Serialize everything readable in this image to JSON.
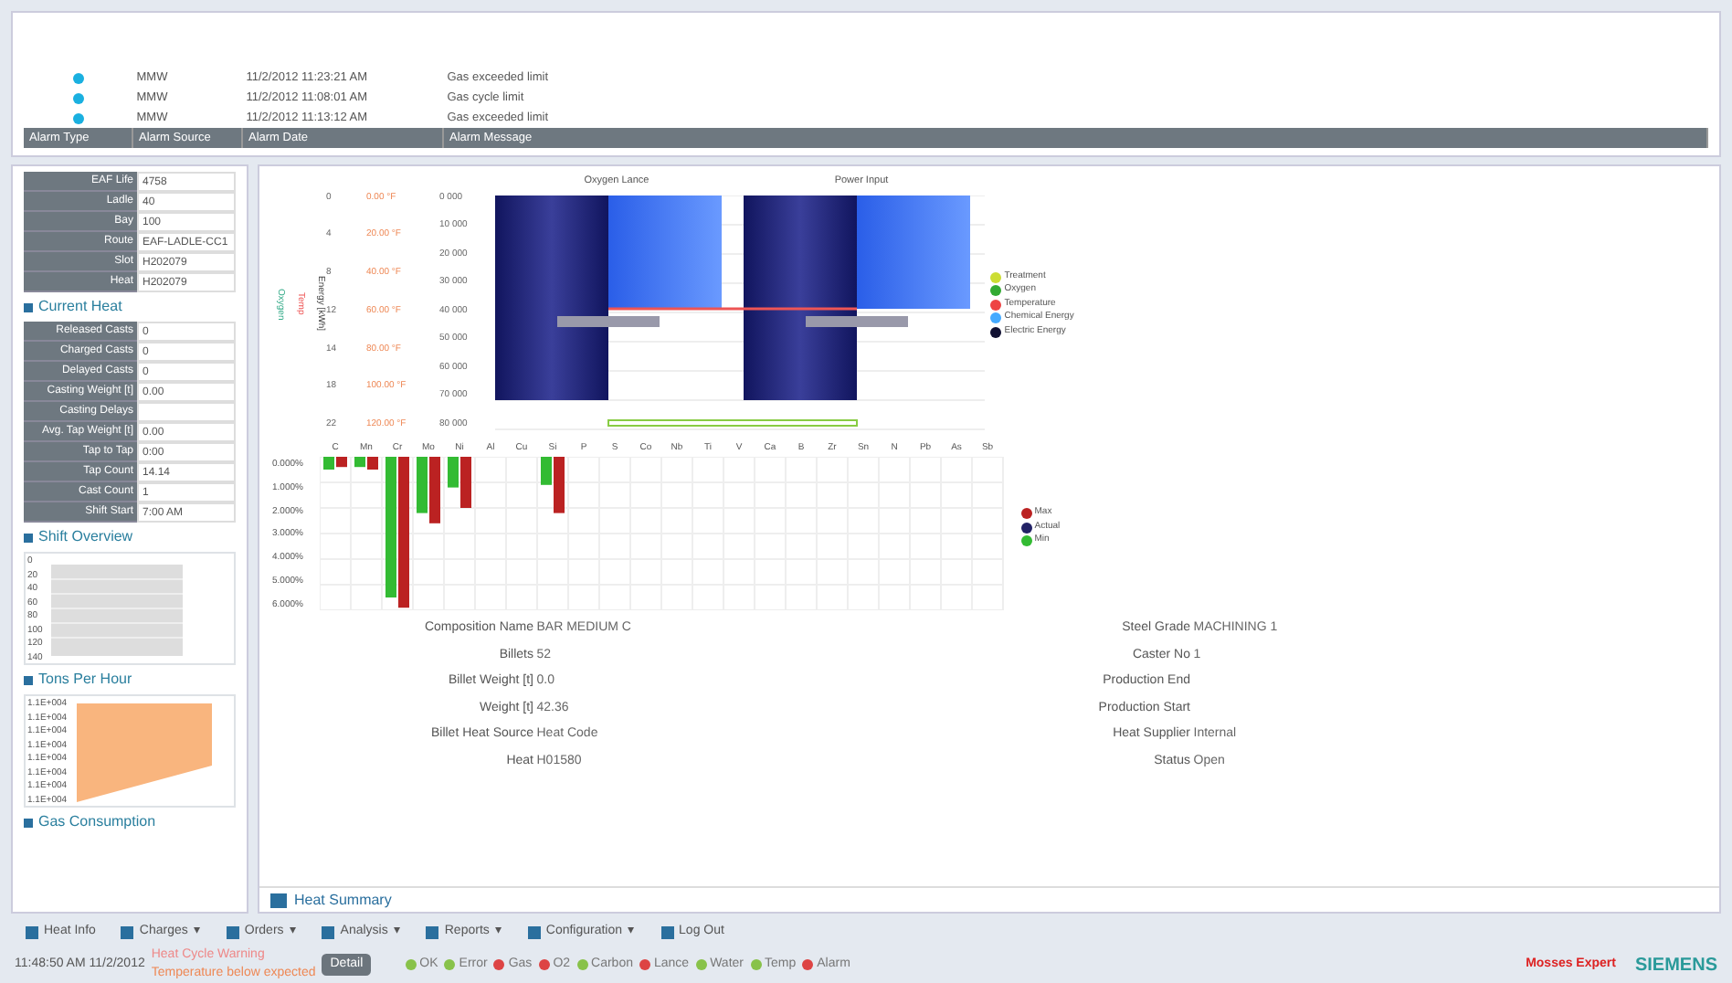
{
  "alarms": {
    "rows": [
      {
        "source": "MMW",
        "date": "11/2/2012 11:23:21 AM",
        "message": "Gas exceeded limit"
      },
      {
        "source": "MMW",
        "date": "11/2/2012 11:08:01 AM",
        "message": "Gas cycle limit"
      },
      {
        "source": "MMW",
        "date": "11/2/2012 11:13:12 AM",
        "message": "Gas exceeded limit"
      }
    ],
    "columns": [
      "Alarm Type",
      "Alarm Source",
      "Alarm Date",
      "Alarm Message"
    ]
  },
  "sidebar": {
    "heat": {
      "title": "Current Heat",
      "rows": [
        {
          "label": "EAF Life",
          "value": "4758"
        },
        {
          "label": "Ladle",
          "value": "40"
        },
        {
          "label": "Bay",
          "value": "100"
        },
        {
          "label": "Route",
          "value": "EAF-LADLE-CC1"
        },
        {
          "label": "Slot",
          "value": "H202079"
        },
        {
          "label": "Heat",
          "value": "H202079"
        }
      ]
    },
    "shift": {
      "title": "Shift Overview",
      "rows": [
        {
          "label": "Released Casts",
          "value": "0"
        },
        {
          "label": "Charged Casts",
          "value": "0"
        },
        {
          "label": "Delayed Casts",
          "value": "0"
        },
        {
          "label": "Casting Weight [t]",
          "value": "0.00"
        },
        {
          "label": "Casting Delays"
        },
        {
          "label": "Avg. Tap Weight [t]",
          "value": "0.00"
        },
        {
          "label": "Tap to Tap",
          "value": "0:00"
        },
        {
          "label": "Tap Count",
          "value": "14.14"
        },
        {
          "label": "Cast Count",
          "value": "1"
        },
        {
          "label": "Shift Start",
          "value": "7:00 AM"
        }
      ]
    },
    "tons": {
      "title": "Tons Per Hour",
      "ticks": [
        "0",
        "20",
        "40",
        "60",
        "80",
        "100",
        "120",
        "140"
      ]
    },
    "gas": {
      "title": "Gas Consumption",
      "ticks": [
        "1.1E+004",
        "1.1E+004",
        "1.1E+004",
        "1.1E+004",
        "1.1E+004",
        "1.1E+004",
        "1.1E+004",
        "1.1E+004"
      ]
    }
  },
  "main": {
    "energy": {
      "titles": [
        "Oxygen Lance",
        "Power Input"
      ],
      "axis_left": [
        "Oxygen",
        "Temp",
        "Energy [kWh]"
      ],
      "ticks_a": [
        "0",
        "4",
        "8",
        "12",
        "14",
        "18",
        "22"
      ],
      "ticks_b": [
        "0.00 °F",
        "20.00 °F",
        "40.00 °F",
        "60.00 °F",
        "80.00 °F",
        "100.00 °F",
        "120.00 °F"
      ],
      "ticks_c": [
        "0 000",
        "10 000",
        "20 000",
        "30 000",
        "40 000",
        "50 000",
        "60 000",
        "70 000",
        "80 000"
      ],
      "legend": [
        "Treatment",
        "Oxygen",
        "Temperature",
        "Chemical Energy",
        "Electric Energy"
      ]
    },
    "elements": {
      "categories": [
        "C",
        "Mn",
        "Cr",
        "Mo",
        "Ni",
        "Al",
        "Cu",
        "Si",
        "P",
        "S",
        "Co",
        "Nb",
        "Ti",
        "V",
        "Ca",
        "B",
        "Zr",
        "Sn",
        "N",
        "Pb",
        "As",
        "Sb"
      ],
      "yticks": [
        "0.000%",
        "1.000%",
        "2.000%",
        "3.000%",
        "4.000%",
        "5.000%",
        "6.000%"
      ],
      "legend": [
        "Max",
        "Actual",
        "Min"
      ]
    },
    "fields_left": [
      {
        "label": "Composition Name",
        "value": "BAR MEDIUM C"
      },
      {
        "label": "Billets",
        "value": "52"
      },
      {
        "label": "Billet Weight [t]",
        "value": "0.0"
      },
      {
        "label": "Weight [t]",
        "value": "42.36"
      },
      {
        "label": "Billet Heat Source",
        "value": "Heat Code"
      },
      {
        "label": "Heat",
        "value": "H01580"
      }
    ],
    "fields_right": [
      {
        "label": "Steel Grade",
        "value": "MACHINING 1"
      },
      {
        "label": "Caster No",
        "value": "1"
      },
      {
        "label": "Production End"
      },
      {
        "label": "Production Start"
      },
      {
        "label": "Heat Supplier",
        "value": "Internal"
      },
      {
        "label": "Status",
        "value": "Open"
      }
    ],
    "title": "Heat Summary"
  },
  "toolbar": [
    {
      "label": "Heat Info"
    },
    {
      "label": "Charges",
      "caret": "▾"
    },
    {
      "label": "Orders",
      "caret": "▾"
    },
    {
      "label": "Analysis",
      "caret": "▾"
    },
    {
      "label": "Reports",
      "caret": "▾"
    },
    {
      "label": "Configuration",
      "caret": "▾"
    },
    {
      "label": "Log Out"
    }
  ],
  "status": {
    "time": "11:48:50 AM",
    "date": "11/2/2012",
    "alarm_title": "Heat Cycle Warning",
    "alarm_text": "Temperature below expected",
    "button": "Detail"
  },
  "status_legend": [
    "OK",
    "Error",
    "Gas",
    "O2",
    "Carbon",
    "Lance",
    "Water",
    "Temp",
    "Alarm"
  ],
  "logos": [
    "Mosses Expert",
    "SIEMENS"
  ]
}
